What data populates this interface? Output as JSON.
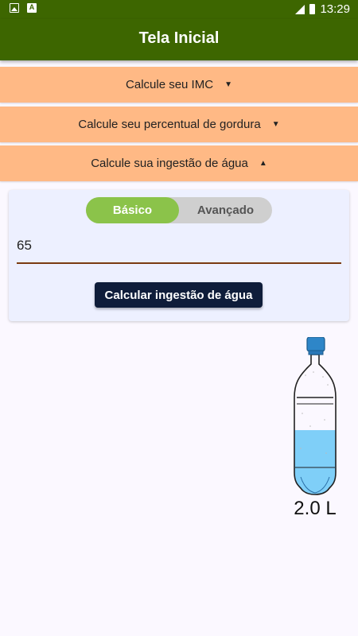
{
  "status_bar": {
    "time": "13:29",
    "notif_font_icon": "A"
  },
  "app_bar": {
    "title": "Tela Inicial"
  },
  "accordion": [
    {
      "label": "Calcule seu IMC",
      "caret": "▼"
    },
    {
      "label": "Calcule seu percentual de gordura",
      "caret": "▼"
    },
    {
      "label": "Calcule sua ingestão de água",
      "caret": "▲"
    }
  ],
  "water_card": {
    "toggle": {
      "basic": "Básico",
      "advanced": "Avançado",
      "selected": "Básico"
    },
    "weight_input": "65",
    "button_label": "Calcular ingestão de água"
  },
  "result": {
    "bottle_label": "2.0 L",
    "fill_fraction": 0.46
  },
  "colors": {
    "app_bar": "#3d6600",
    "accordion": "#ffb985",
    "toggle_active": "#8bc34a",
    "button": "#0f1d3a",
    "water": "#7fcff8"
  }
}
